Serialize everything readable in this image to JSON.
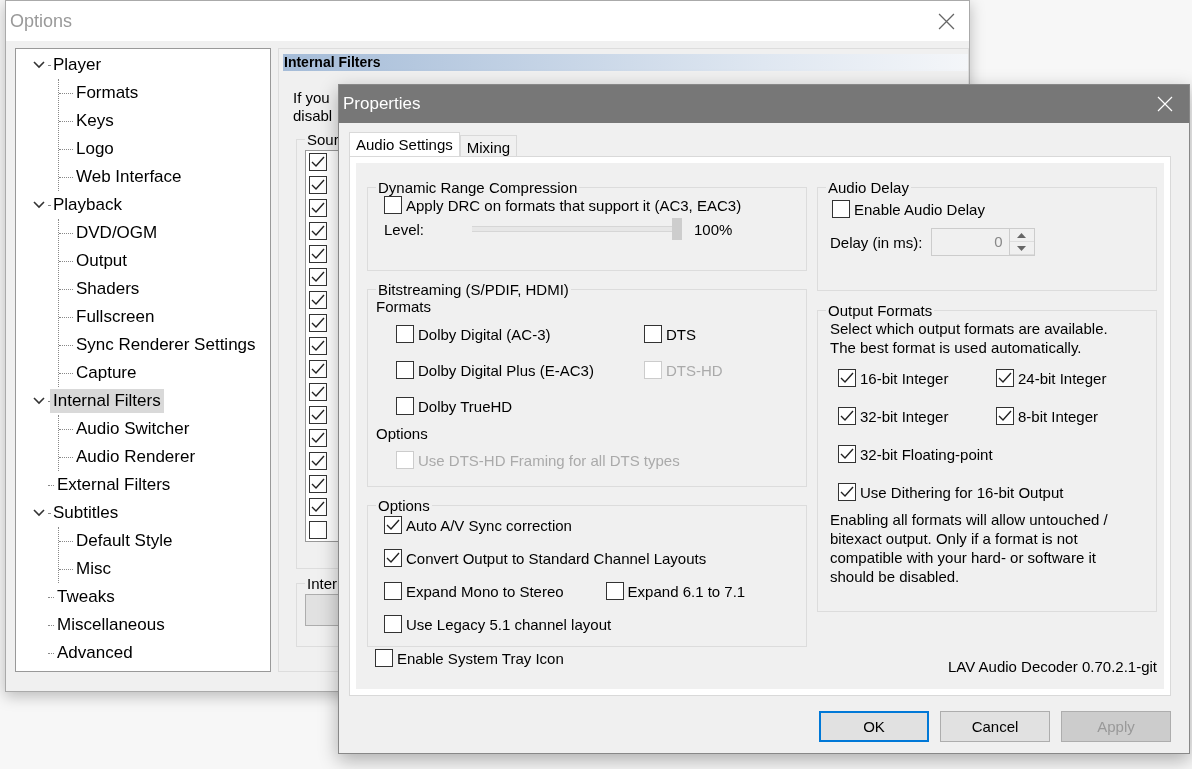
{
  "options_window": {
    "title": "Options",
    "tree": [
      {
        "label": "Player",
        "expanded": true,
        "selected": false,
        "children": [
          {
            "label": "Formats",
            "selected": false
          },
          {
            "label": "Keys",
            "selected": false
          },
          {
            "label": "Logo",
            "selected": false
          },
          {
            "label": "Web Interface",
            "selected": false
          }
        ]
      },
      {
        "label": "Playback",
        "expanded": true,
        "selected": false,
        "children": [
          {
            "label": "DVD/OGM",
            "selected": false
          },
          {
            "label": "Output",
            "selected": false
          },
          {
            "label": "Shaders",
            "selected": false
          },
          {
            "label": "Fullscreen",
            "selected": false
          },
          {
            "label": "Sync Renderer Settings",
            "selected": false
          },
          {
            "label": "Capture",
            "selected": false
          }
        ]
      },
      {
        "label": "Internal Filters",
        "expanded": true,
        "selected": true,
        "children": [
          {
            "label": "Audio Switcher",
            "selected": false
          },
          {
            "label": "Audio Renderer",
            "selected": false
          }
        ]
      },
      {
        "label": "External Filters",
        "selected": false
      },
      {
        "label": "Subtitles",
        "expanded": true,
        "selected": false,
        "children": [
          {
            "label": "Default Style",
            "selected": false
          },
          {
            "label": "Misc",
            "selected": false
          }
        ]
      },
      {
        "label": "Tweaks",
        "selected": false
      },
      {
        "label": "Miscellaneous",
        "selected": false
      },
      {
        "label": "Advanced",
        "selected": false
      }
    ],
    "panel": {
      "header": "Internal Filters",
      "description_lines": [
        "If you",
        "disabl"
      ],
      "source_group": {
        "title": "Sour",
        "items": [
          {
            "checked": true
          },
          {
            "checked": true
          },
          {
            "checked": true
          },
          {
            "checked": true
          },
          {
            "checked": true
          },
          {
            "checked": true
          },
          {
            "checked": true
          },
          {
            "checked": true
          },
          {
            "checked": true
          },
          {
            "checked": true
          },
          {
            "checked": true
          },
          {
            "checked": true
          },
          {
            "checked": true
          },
          {
            "checked": true
          },
          {
            "checked": true
          },
          {
            "checked": true
          },
          {
            "checked": false
          }
        ]
      },
      "internal_group": {
        "title": "Inter"
      }
    }
  },
  "properties_dialog": {
    "title": "Properties",
    "tabs": [
      {
        "label": "Audio Settings",
        "selected": true
      },
      {
        "label": "Mixing",
        "selected": false
      }
    ],
    "drc": {
      "title": "Dynamic Range Compression",
      "checkbox": {
        "label": "Apply DRC on formats that support it (AC3, EAC3)",
        "checked": false
      },
      "level_label": "Level:",
      "level": 1,
      "reading": "100%"
    },
    "bitstreaming": {
      "title": "Bitstreaming (S/PDIF, HDMI)",
      "formats_label": "Formats",
      "formats": [
        {
          "label": "Dolby Digital (AC-3)",
          "checked": false,
          "disabled": false
        },
        {
          "label": "DTS",
          "checked": false,
          "disabled": false
        },
        {
          "label": "Dolby Digital Plus (E-AC3)",
          "checked": false,
          "disabled": false
        },
        {
          "label": "DTS-HD",
          "checked": false,
          "disabled": true
        },
        {
          "label": "Dolby TrueHD",
          "checked": false,
          "disabled": false
        }
      ],
      "options_label": "Options",
      "options": [
        {
          "label": "Use DTS-HD Framing for all DTS types",
          "checked": false,
          "disabled": true
        }
      ]
    },
    "options": {
      "title": "Options",
      "rows": [
        [
          {
            "label": "Auto A/V Sync correction",
            "checked": true
          }
        ],
        [
          {
            "label": "Convert Output to Standard Channel Layouts",
            "checked": true
          }
        ],
        [
          {
            "label": "Expand Mono to Stereo",
            "checked": false
          },
          {
            "label": "Expand 6.1 to 7.1",
            "checked": false
          }
        ],
        [
          {
            "label": "Use Legacy 5.1 channel layout",
            "checked": false
          }
        ]
      ]
    },
    "system_tray": {
      "label": "Enable System Tray Icon",
      "checked": false
    },
    "audio_delay": {
      "title": "Audio Delay",
      "checkbox": {
        "label": "Enable Audio Delay",
        "checked": false
      },
      "delay_label": "Delay (in ms):",
      "delay_value": "0",
      "disabled": true
    },
    "output_formats": {
      "title": "Output Formats",
      "description_lines": [
        "Select which output formats are available.",
        "The best format is used automatically."
      ],
      "formats": [
        {
          "label": "16-bit Integer",
          "checked": true
        },
        {
          "label": "24-bit Integer",
          "checked": true
        },
        {
          "label": "32-bit Integer",
          "checked": true
        },
        {
          "label": "8-bit Integer",
          "checked": true
        },
        {
          "label": "32-bit Floating-point",
          "checked": true
        }
      ],
      "dithering": {
        "label": "Use Dithering for 16-bit Output",
        "checked": true
      },
      "note_lines": [
        "Enabling all formats will allow untouched /",
        "bitexact output. Only if a format is not",
        "compatible with your hard- or software it",
        "should be disabled."
      ]
    },
    "version": "LAV Audio Decoder 0.70.2.1-git",
    "buttons": [
      {
        "label": "OK",
        "kind": "default"
      },
      {
        "label": "Cancel",
        "kind": "normal"
      },
      {
        "label": "Apply",
        "kind": "disabled"
      }
    ]
  }
}
